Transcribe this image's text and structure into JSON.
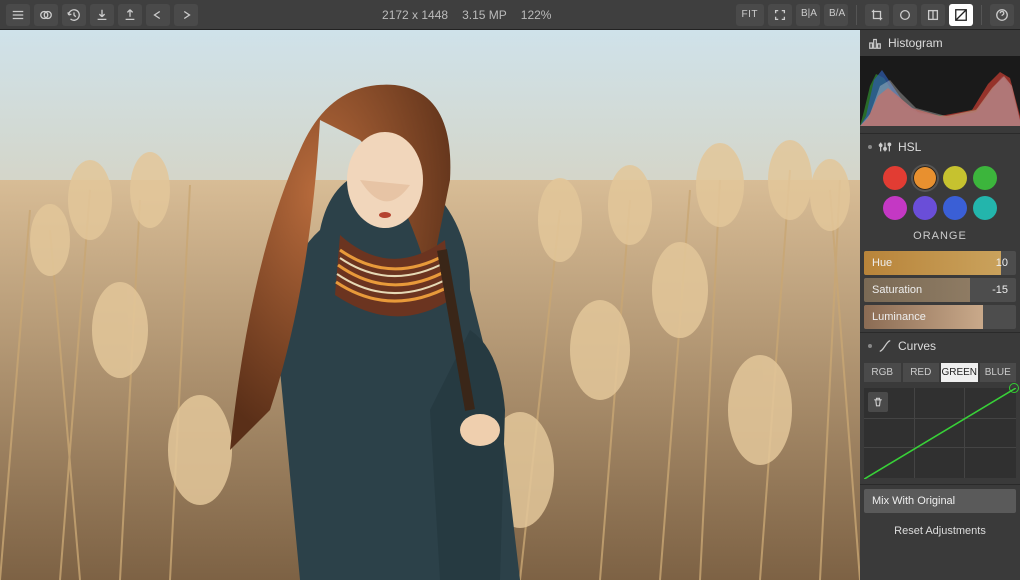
{
  "toolbar": {
    "info": {
      "dimensions": "2172 x 1448",
      "megapixels": "3.15 MP",
      "zoom": "122%"
    },
    "fit_label": "FIT",
    "compare_label": "B|A",
    "split_label": "B/A"
  },
  "panel": {
    "histogram": {
      "label": "Histogram"
    },
    "hsl": {
      "label": "HSL",
      "colors": [
        {
          "name": "red",
          "hex": "#e23c33"
        },
        {
          "name": "orange",
          "hex": "#e8902f"
        },
        {
          "name": "yellow",
          "hex": "#c6c22f"
        },
        {
          "name": "green",
          "hex": "#3cb53c"
        },
        {
          "name": "magenta",
          "hex": "#c438c4"
        },
        {
          "name": "purple",
          "hex": "#6a4ed8"
        },
        {
          "name": "blue",
          "hex": "#3a5fd6"
        },
        {
          "name": "aqua",
          "hex": "#23b5ac"
        }
      ],
      "selected_index": 1,
      "selected_label": "ORANGE",
      "sliders": {
        "hue": {
          "label": "Hue",
          "value": "10"
        },
        "saturation": {
          "label": "Saturation",
          "value": "-15"
        },
        "luminance": {
          "label": "Luminance",
          "value": ""
        }
      }
    },
    "curves": {
      "label": "Curves",
      "tabs": [
        "RGB",
        "RED",
        "GREEN",
        "BLUE"
      ],
      "active_index": 2
    },
    "mix_label": "Mix With Original",
    "reset_label": "Reset Adjustments"
  }
}
